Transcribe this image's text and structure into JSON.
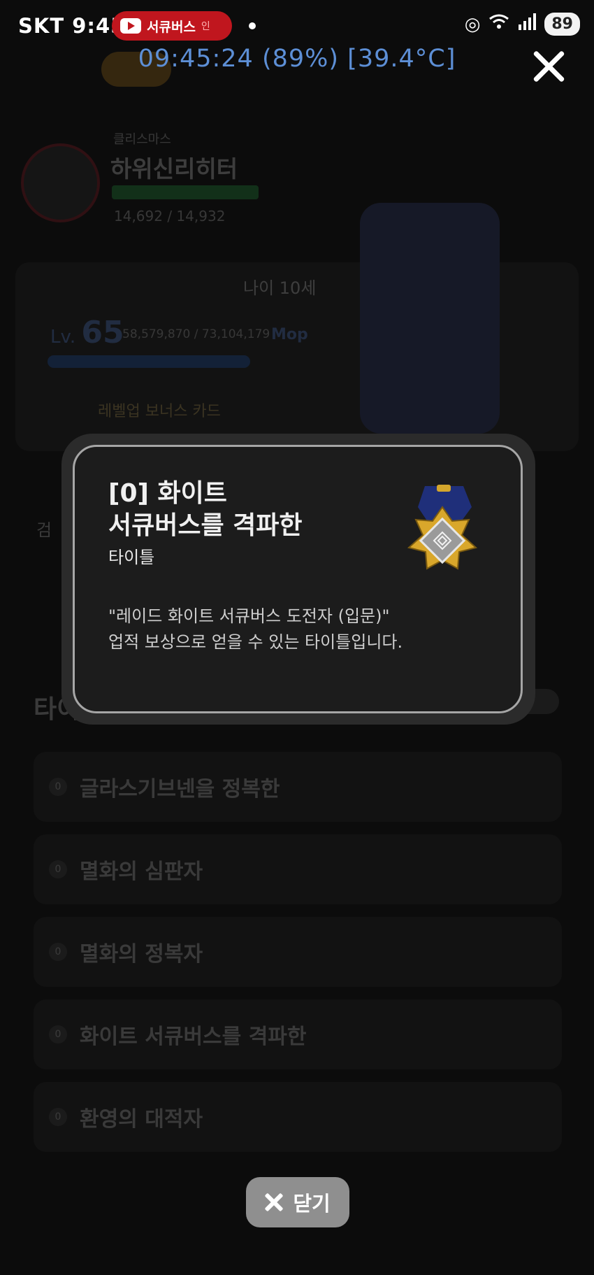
{
  "status_bar": {
    "carrier_time": "SKT 9:45",
    "youtube_label": "서큐버스",
    "youtube_live": "인",
    "battery": "89",
    "overlay_clock": "09:45:24 (89%) [39.4°C]"
  },
  "background": {
    "profile": {
      "subtitle": "클리스마스",
      "name": "하위신리히터",
      "exp": "14,692 / 14,932"
    },
    "card": {
      "age": "나이 10세",
      "lv_prefix": "Lv.",
      "level": "65",
      "lv_exp": "58,579,870 / 73,104,179",
      "lv_unit": "Mop",
      "bonus": "레벨업 보너스 카드"
    },
    "side_label": "검",
    "section_title": "타이",
    "list": [
      {
        "badge": "0",
        "label": "글라스기브넨을 정복한"
      },
      {
        "badge": "0",
        "label": "멸화의 심판자"
      },
      {
        "badge": "0",
        "label": "멸화의 정복자"
      },
      {
        "badge": "0",
        "label": "화이트 서큐버스를 격파한"
      },
      {
        "badge": "0",
        "label": "환영의 대적자"
      }
    ]
  },
  "modal": {
    "title_line1": "[0] 화이트",
    "title_line2": "서큐버스를 격파한",
    "type": "타이틀",
    "desc_line1": "\"레이드 화이트 서큐버스 도전자 (입문)\"",
    "desc_line2": "업적 보상으로 얻을 수 있는 타이틀입니다.",
    "icon": "medal-icon"
  },
  "close_button": {
    "label": "닫기"
  }
}
